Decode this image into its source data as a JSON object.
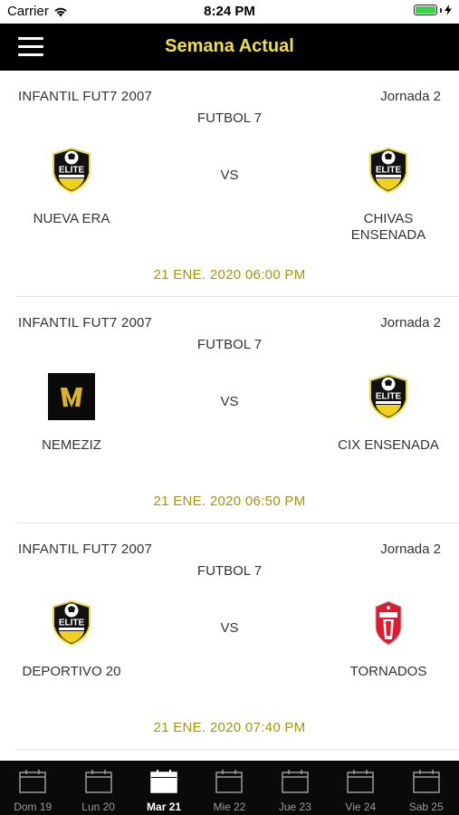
{
  "status_bar": {
    "carrier": "Carrier",
    "time": "8:24 PM"
  },
  "header": {
    "title": "Semana Actual"
  },
  "matches": [
    {
      "league": "INFANTIL FUT7 2007",
      "round": "Jornada 2",
      "sport": "FUTBOL 7",
      "vs": "VS",
      "home": {
        "name": "NUEVA ERA",
        "logo": "elite-soccer-logo"
      },
      "away": {
        "name": "CHIVAS ENSENADA",
        "logo": "elite-soccer-logo"
      },
      "datetime": "21 ENE. 2020 06:00 PM"
    },
    {
      "league": "INFANTIL FUT7 2007",
      "round": "Jornada 2",
      "sport": "FUTBOL 7",
      "vs": "VS",
      "home": {
        "name": "NEMEZIZ",
        "logo": "nemeziz-logo"
      },
      "away": {
        "name": "CIX ENSENADA",
        "logo": "elite-soccer-logo"
      },
      "datetime": "21 ENE. 2020 06:50 PM"
    },
    {
      "league": "INFANTIL FUT7 2007",
      "round": "Jornada 2",
      "sport": "FUTBOL 7",
      "vs": "VS",
      "home": {
        "name": "DEPORTIVO 20",
        "logo": "elite-soccer-logo"
      },
      "away": {
        "name": "TORNADOS",
        "logo": "toronto-fc-logo"
      },
      "datetime": "21 ENE. 2020 07:40 PM"
    }
  ],
  "tabs": [
    {
      "label": "Dom 19",
      "active": false
    },
    {
      "label": "Lun 20",
      "active": false
    },
    {
      "label": "Mar 21",
      "active": true
    },
    {
      "label": "Mie 22",
      "active": false
    },
    {
      "label": "Jue 23",
      "active": false
    },
    {
      "label": "Vie 24",
      "active": false
    },
    {
      "label": "Sab 25",
      "active": false
    }
  ],
  "colors": {
    "nav_background": "#000000",
    "title_color": "#f0e13b",
    "date_color": "#a3940f",
    "tab_background": "#0a0a0a",
    "battery": "#3bd14b"
  }
}
